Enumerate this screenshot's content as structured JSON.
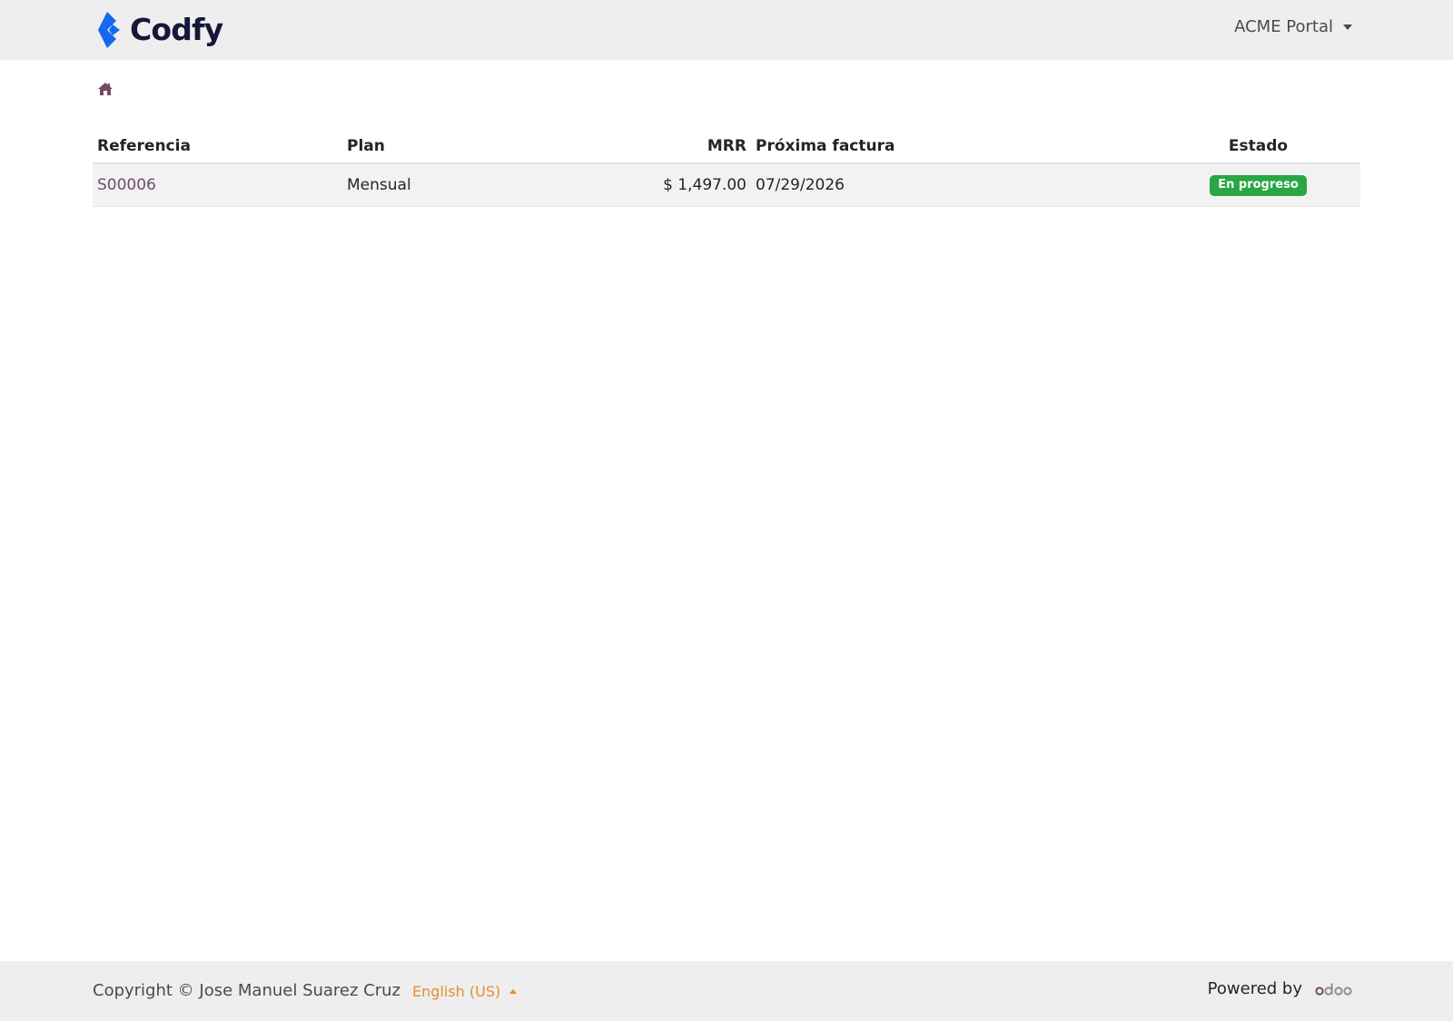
{
  "header": {
    "brand_name": "Codfy",
    "portal_menu_label": "ACME Portal"
  },
  "breadcrumb": {
    "home_icon": "home-icon"
  },
  "table": {
    "columns": {
      "reference": "Referencia",
      "plan": "Plan",
      "mrr": "MRR",
      "next_invoice": "Próxima factura",
      "state": "Estado"
    },
    "rows": [
      {
        "reference": "S00006",
        "plan": "Mensual",
        "mrr": "$ 1,497.00",
        "next_invoice": "07/29/2026",
        "state": "En progreso"
      }
    ]
  },
  "footer": {
    "copyright": "Copyright © Jose Manuel Suarez Cruz",
    "language": "English (US)",
    "powered_by": "Powered by",
    "powered_logo": "odoo-logo"
  },
  "colors": {
    "bar_bg": "#eeeeee",
    "brand_blue": "#1668f0",
    "brand_text": "#17173a",
    "link_purple": "#714b67",
    "status_green": "#28a745",
    "language_orange": "#e38f30"
  }
}
